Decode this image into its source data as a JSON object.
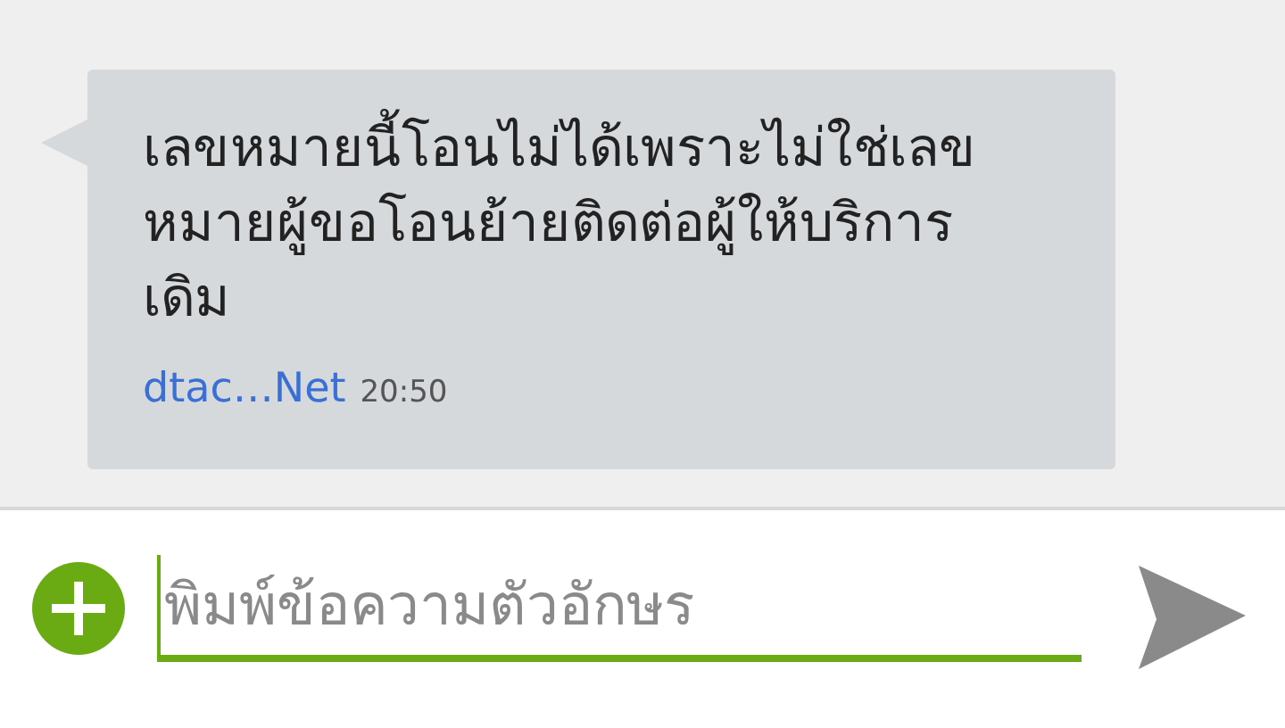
{
  "messages": [
    {
      "text": "เลขหมายนี้โอนไม่ได้เพราะไม่ใช่เลขหมายผู้ขอโอนย้ายติดต่อผู้ให้บริการเดิม",
      "sender": "dtac…Net",
      "time": "20:50"
    }
  ],
  "composer": {
    "placeholder": "พิมพ์ข้อความตัวอักษร"
  }
}
